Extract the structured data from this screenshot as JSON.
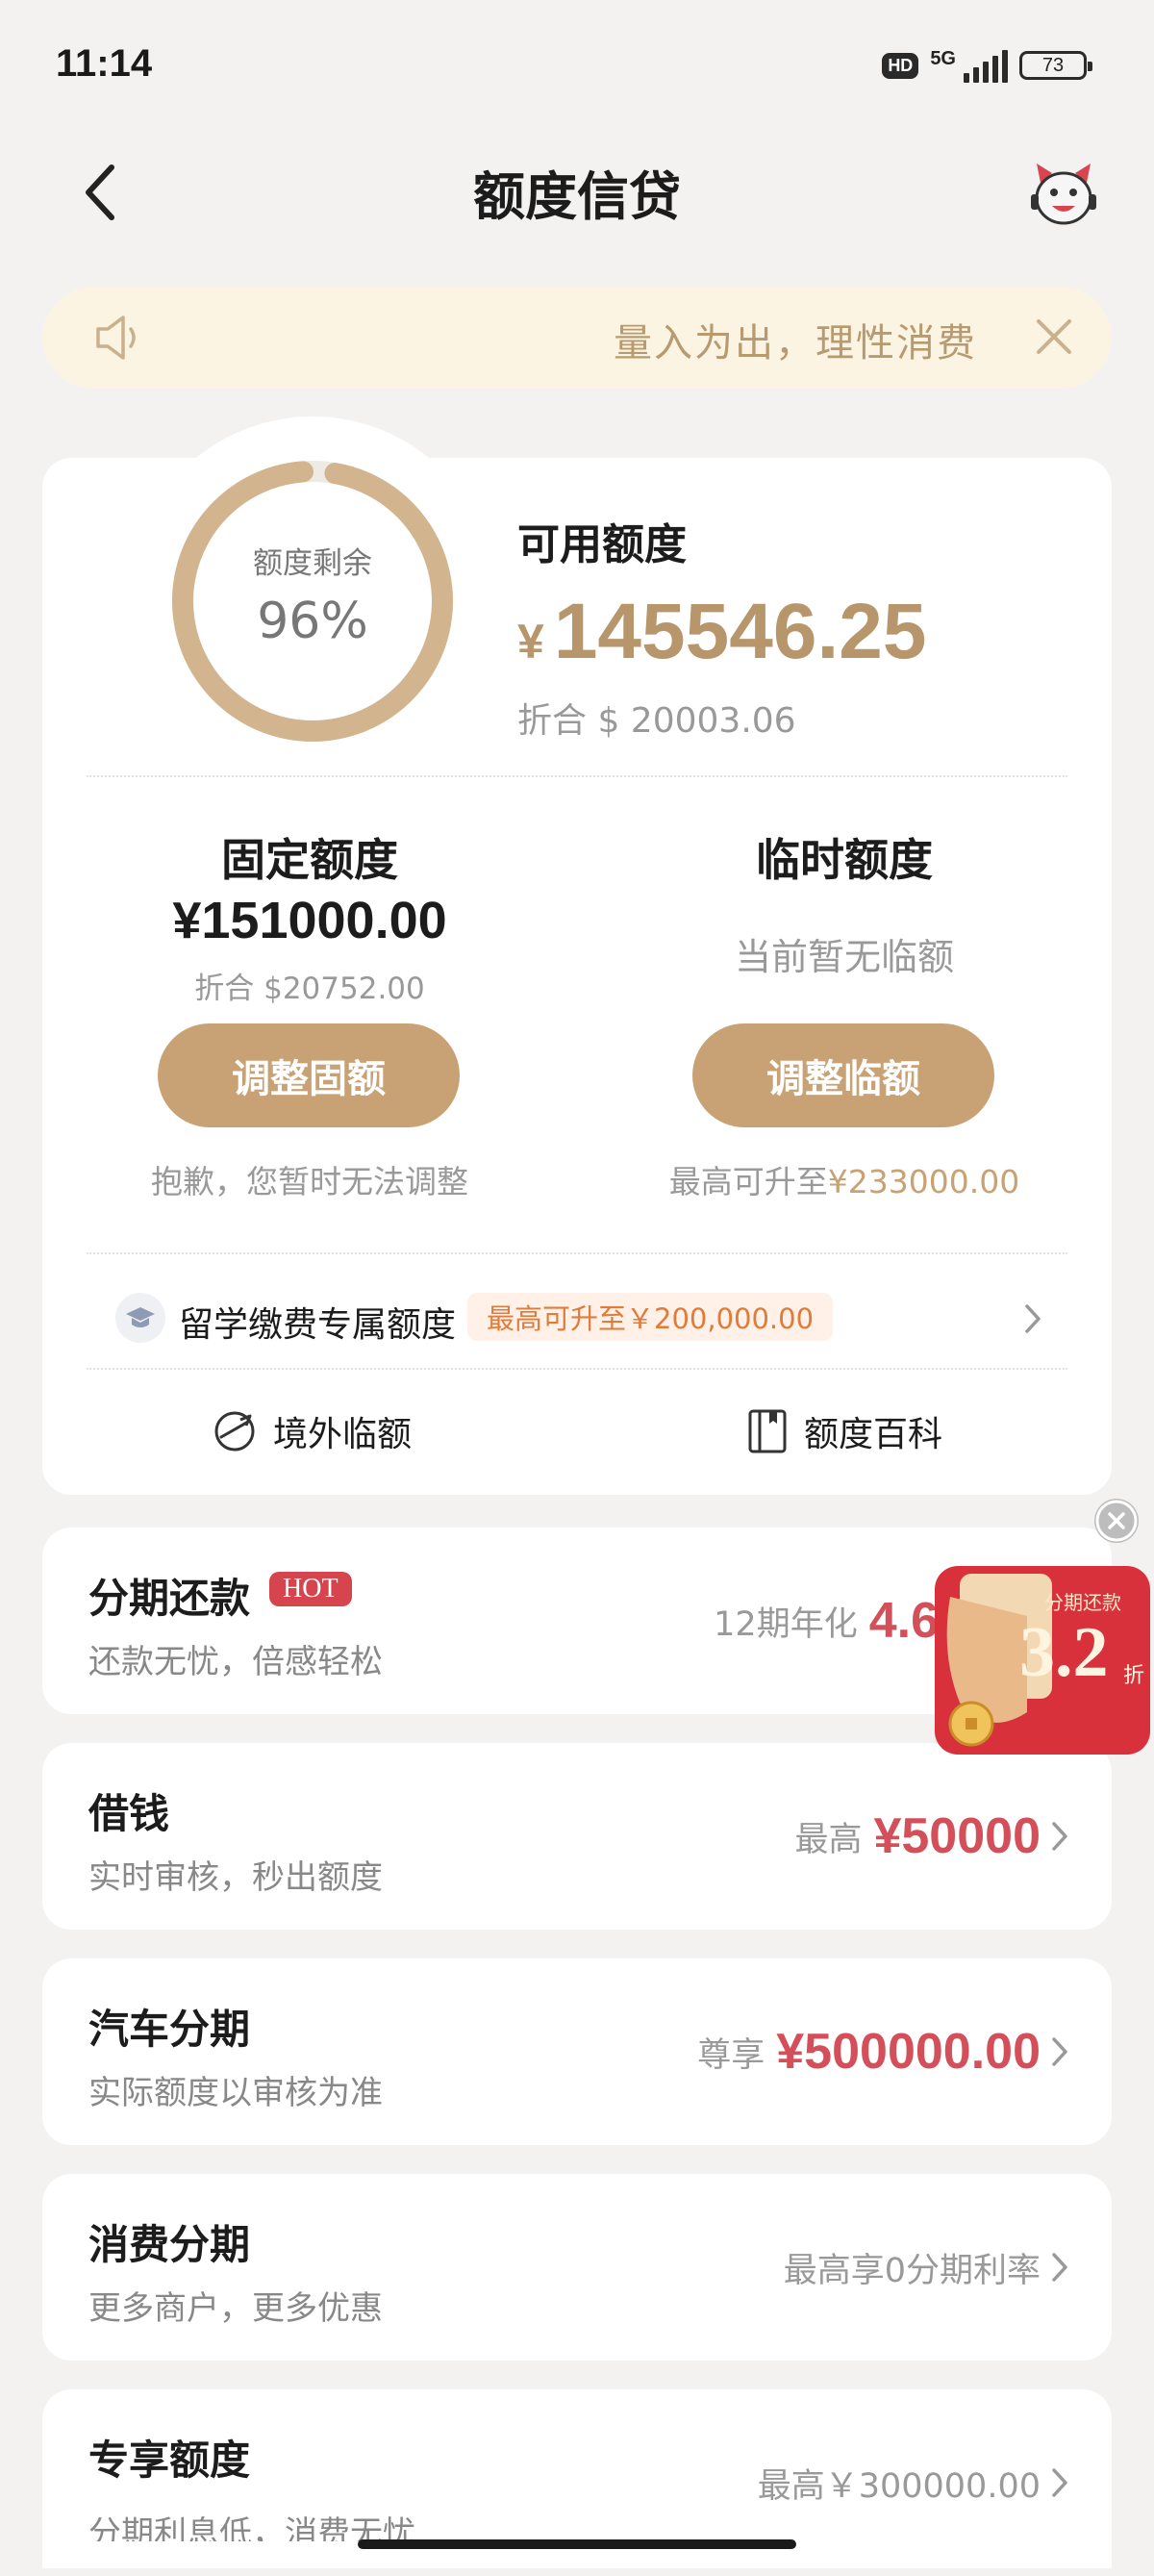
{
  "status": {
    "time": "11:14",
    "hd": "HD",
    "network": "5G",
    "battery": "73"
  },
  "nav": {
    "title": "额度信贷"
  },
  "notice": {
    "text": "量入为出，理性消费"
  },
  "quota": {
    "ring_label": "额度剩余",
    "ring_value": "96%",
    "ring_percent": 96,
    "available_title": "可用额度",
    "currency": "¥",
    "available_amount": "145546.25",
    "available_converted": "折合 $ 20003.06"
  },
  "fixed": {
    "title": "固定额度",
    "amount": "¥151000.00",
    "converted": "折合 $20752.00",
    "button": "调整固额",
    "note": "抱歉，您暂时无法调整"
  },
  "temporary": {
    "title": "临时额度",
    "status": "当前暂无临额",
    "button": "调整临额",
    "note_prefix": "最高可升至",
    "note_amount": "¥233000.00"
  },
  "study": {
    "label": "留学缴费专属额度",
    "badge": "最高可升至￥200,000.00"
  },
  "links": {
    "overseas": "境外临额",
    "encyclopedia": "额度百科"
  },
  "list": [
    {
      "title": "分期还款",
      "badge": "HOT",
      "subtitle": "还款无忧，倍感轻松",
      "right_label": "12期年化",
      "right_value": "4.6"
    },
    {
      "title": "借钱",
      "subtitle": "实时审核，秒出额度",
      "right_label": "最高",
      "right_value": "¥50000"
    },
    {
      "title": "汽车分期",
      "subtitle": "实际额度以审核为准",
      "right_label": "尊享",
      "right_value": "¥500000.00"
    },
    {
      "title": "消费分期",
      "subtitle": "更多商户，更多优惠",
      "right_label": "最高享0分期利率"
    },
    {
      "title": "专享额度",
      "subtitle": "分期利息低，消费无忧",
      "right_label": "最高￥300000.00"
    }
  ],
  "promo": {
    "label": "分期还款",
    "value": "3.2",
    "unit": "折"
  },
  "colors": {
    "gold": "#c8a274",
    "red": "#d3505a",
    "notice_bg": "#fbf4e3"
  }
}
